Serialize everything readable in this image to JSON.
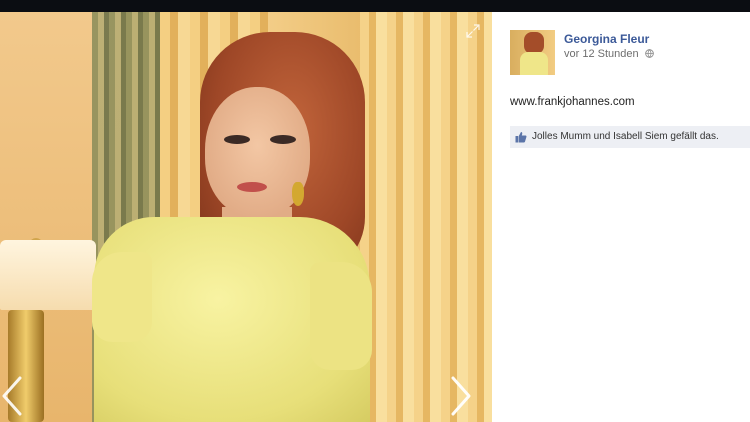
{
  "photo_viewer": {
    "author": "Georgina Fleur",
    "timestamp": "vor 12 Stunden",
    "caption": "www.frankjohannes.com",
    "likes_text": "Jolles Mumm und Isabell Siem gefällt das."
  },
  "icons": {
    "expand": "expand-icon",
    "previous": "chevron-left-icon",
    "next": "chevron-right-icon",
    "privacy": "globe-icon",
    "like": "thumbs-up-icon"
  },
  "colors": {
    "link_blue": "#3b5998",
    "likes_background": "#edeff4"
  }
}
